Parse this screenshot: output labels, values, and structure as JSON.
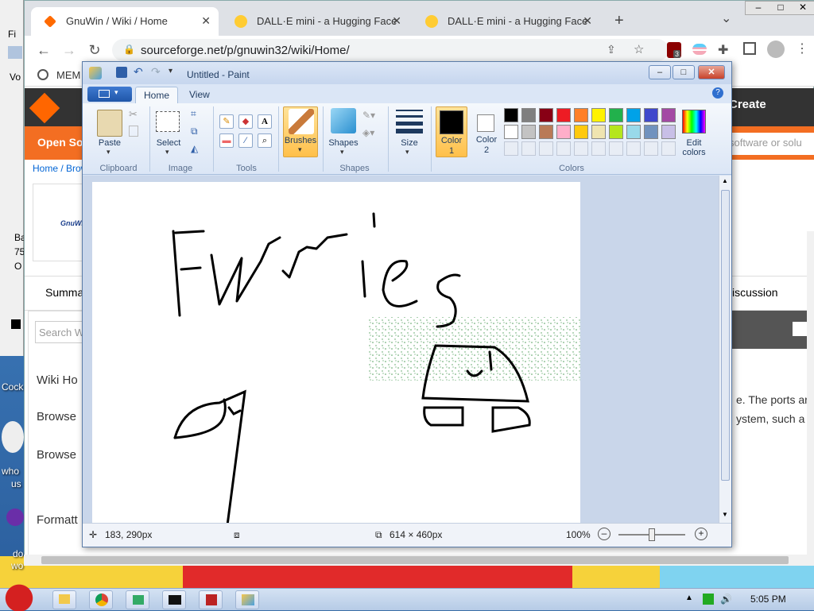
{
  "desktop": {
    "labels": [
      "Cock",
      "who",
      "us",
      "do",
      "wo"
    ]
  },
  "bg_window": {
    "menu_first": "Fi",
    "text_a": "Vo",
    "text_b": "Ba",
    "text_c": "75",
    "text_d": "O"
  },
  "browser": {
    "tabs": [
      {
        "title": "GnuWin / Wiki / Home",
        "active": true
      },
      {
        "title": "DALL·E mini - a Hugging Face",
        "active": false
      },
      {
        "title": "DALL·E mini - a Hugging Face",
        "active": false
      }
    ],
    "new_tab": "+",
    "tab_menu": "⌄",
    "url": "sourceforge.net/p/gnuwin32/wiki/Home/",
    "bookmark_label": "MEM",
    "extension_badge": "3"
  },
  "page": {
    "create_label": "Create",
    "search_placeholder": "software or solu",
    "open_source_label": "Open So",
    "breadcrumb": "Home / Brow",
    "logo_text": "GnuWin",
    "nav_summary": "Summa",
    "nav_discussion": "iscussion",
    "search_wiki_placeholder": "Search W",
    "sidebar_items": [
      "Wiki Ho",
      "Browse",
      "Browse",
      "Formatt"
    ],
    "body_text_1": "e. The ports ar",
    "body_text_2": "ystem, such a"
  },
  "paint": {
    "title": "Untitled - Paint",
    "tabs": [
      "Home",
      "View"
    ],
    "groups": {
      "clipboard": "Clipboard",
      "image": "Image",
      "tools": "Tools",
      "shapes": "Shapes",
      "colors": "Colors"
    },
    "buttons": {
      "paste": "Paste",
      "select": "Select",
      "brushes": "Brushes",
      "shapes": "Shapes",
      "size": "Size",
      "color1_line1": "Color",
      "color1_line2": "1",
      "color2_line1": "Color",
      "color2_line2": "2",
      "edit_colors_line1": "Edit",
      "edit_colors_line2": "colors"
    },
    "palette_row1": [
      "#000000",
      "#7f7f7f",
      "#880015",
      "#ed1c24",
      "#ff7f27",
      "#fff200",
      "#22b14c",
      "#00a2e8",
      "#3f48cc",
      "#a349a4"
    ],
    "palette_row2": [
      "#ffffff",
      "#c3c3c3",
      "#b97a57",
      "#ffaec9",
      "#ffc90e",
      "#efe4b0",
      "#b5e61d",
      "#99d9ea",
      "#7092be",
      "#c8bfe7"
    ],
    "color1": "#000000",
    "color2": "#ffffff",
    "canvas_text": "Furries",
    "status": {
      "cursor_pos": "183, 290px",
      "canvas_size": "614 × 460px",
      "zoom": "100%"
    }
  },
  "taskbar": {
    "clock": "5:05 PM"
  }
}
